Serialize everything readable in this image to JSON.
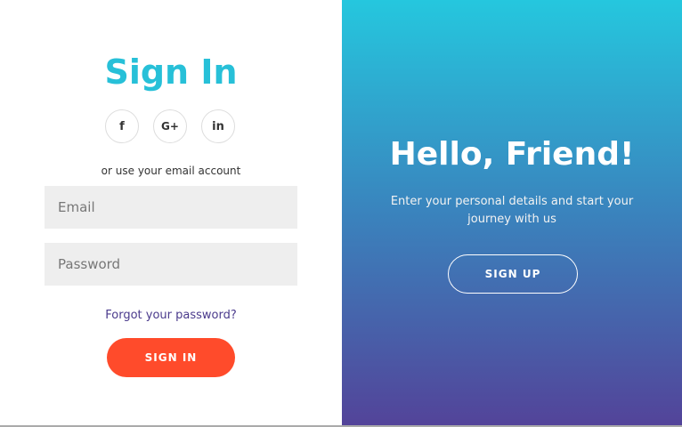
{
  "sign_in": {
    "title": "Sign In",
    "social": [
      {
        "label": "f",
        "icon": "facebook-icon"
      },
      {
        "label": "G+",
        "icon": "google-plus-icon"
      },
      {
        "label": "in",
        "icon": "linkedin-icon"
      }
    ],
    "hint": "or use your email account",
    "email_placeholder": "Email",
    "password_placeholder": "Password",
    "forgot_label": "Forgot your password?",
    "button_label": "SIGN IN"
  },
  "overlay": {
    "heading": "Hello, Friend!",
    "description": "Enter your personal details and start your journey with us",
    "button_label": "SIGN UP"
  },
  "colors": {
    "accent_title": "#27c0d8",
    "sign_in_button": "#ff4b2b",
    "gradient_top": "#25c7de",
    "gradient_bottom": "#534399",
    "link": "#4a3a8c",
    "input_bg": "#eeeeee"
  }
}
